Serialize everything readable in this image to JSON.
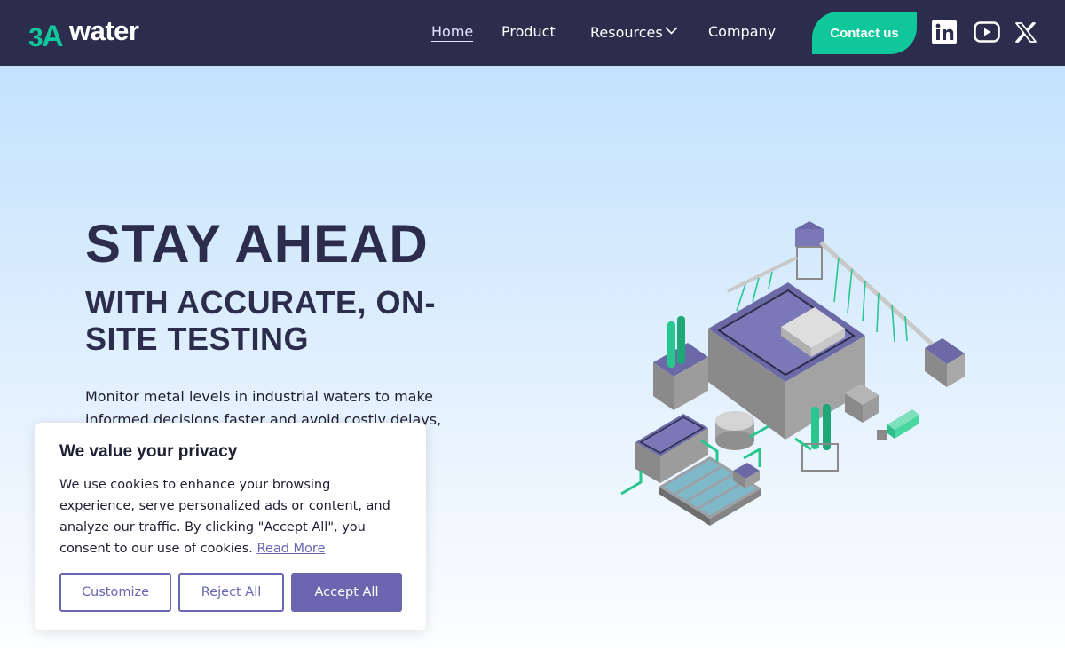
{
  "nav": {
    "logo_text": "water",
    "logo_mark": "3A",
    "links": {
      "home": "Home",
      "product": "Product",
      "resources": "Resources",
      "company": "Company"
    },
    "contact_label": "Contact us",
    "socials": [
      "linkedin-icon",
      "youtube-icon",
      "x-icon"
    ]
  },
  "hero": {
    "title": "STAY AHEAD",
    "subtitle": "WITH ACCURATE, ON-SITE TESTING",
    "body": "Monitor metal levels in industrial waters to make informed decisions faster and avoid costly delays, production issues and"
  },
  "cookie": {
    "title": "We value your privacy",
    "text": "We use cookies to enhance your browsing experience, serve personalized ads or content, and analyze our traffic. By clicking \"Accept All\", you consent to our use of cookies.",
    "read_more": "Read More",
    "customize": "Customize",
    "reject": "Reject All",
    "accept": "Accept All"
  },
  "colors": {
    "nav_bg": "#2c2c4c",
    "accent_green": "#0fc79a",
    "accent_purple": "#6a67b0",
    "heading": "#2c2c4c"
  }
}
